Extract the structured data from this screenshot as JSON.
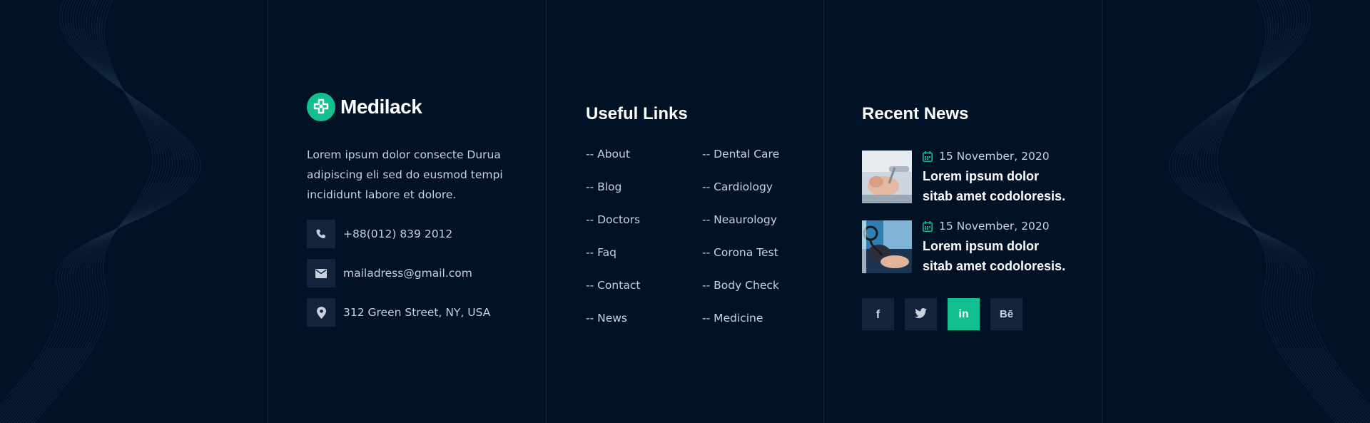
{
  "brand": {
    "name": "Medilack",
    "accent": "#12c08f",
    "background": "#011126",
    "panel": "#12233b"
  },
  "about": {
    "description": "Lorem ipsum dolor consecte Durua adipiscing eli sed do eusmod tempi incididunt labore et dolore.",
    "contacts": [
      {
        "icon": "phone-icon",
        "text": "+88(012) 839 2012"
      },
      {
        "icon": "envelope-icon",
        "text": "mailadress@gmail.com"
      },
      {
        "icon": "map-pin-icon",
        "text": "312 Green Street, NY, USA"
      }
    ]
  },
  "useful_links": {
    "title": "Useful Links",
    "col1": [
      "-- About",
      "-- Blog",
      "-- Doctors",
      "-- Faq",
      "-- Contact",
      "-- News"
    ],
    "col2": [
      "-- Dental Care",
      "-- Cardiology",
      "-- Neaurology",
      "-- Corona Test",
      "-- Body Check",
      "-- Medicine"
    ]
  },
  "recent_news": {
    "title": "Recent News",
    "items": [
      {
        "date": "15 November, 2020",
        "title": "Lorem ipsum dolor sitab amet codoloresis."
      },
      {
        "date": "15 November, 2020",
        "title": "Lorem ipsum dolor sitab amet codoloresis."
      }
    ]
  },
  "socials": [
    {
      "icon": "facebook-icon",
      "label": "f",
      "active": false
    },
    {
      "icon": "twitter-icon",
      "label": "",
      "active": false
    },
    {
      "icon": "linkedin-icon",
      "label": "in",
      "active": true
    },
    {
      "icon": "behance-icon",
      "label": "Bē",
      "active": false
    }
  ]
}
